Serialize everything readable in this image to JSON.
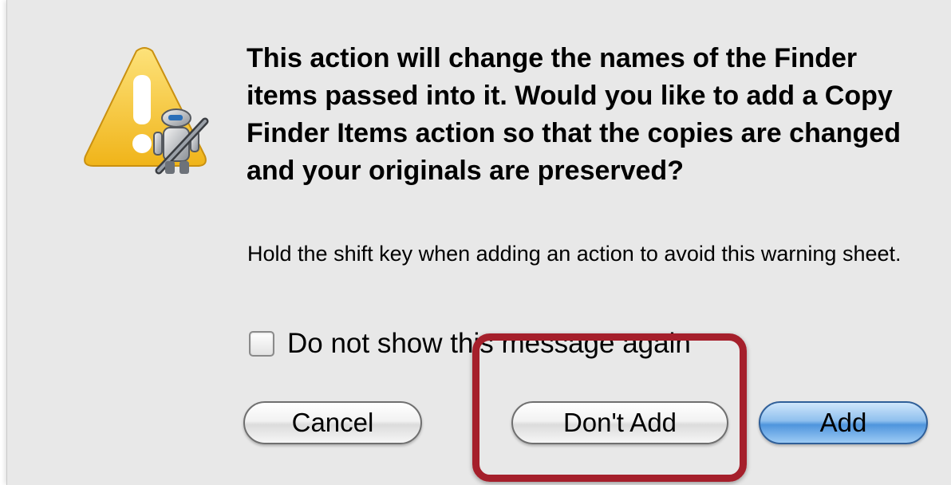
{
  "dialog": {
    "icon": "automator-warning-icon",
    "message_title": "This action will change the names of the Finder items passed into it.  Would you like to add a Copy Finder Items action so that the copies are changed and your originals are preserved?",
    "message_info": "Hold the shift key when adding an action to avoid this warning sheet.",
    "checkbox": {
      "label": "Do not show this message again",
      "checked": false
    },
    "buttons": {
      "cancel": "Cancel",
      "dont_add": "Don't Add",
      "add": "Add"
    },
    "colors": {
      "sheet_background": "#e8e8e8",
      "default_button": "#4f95dd",
      "highlight": "#a51f2b",
      "warning_yellow": "#f6c630"
    }
  }
}
